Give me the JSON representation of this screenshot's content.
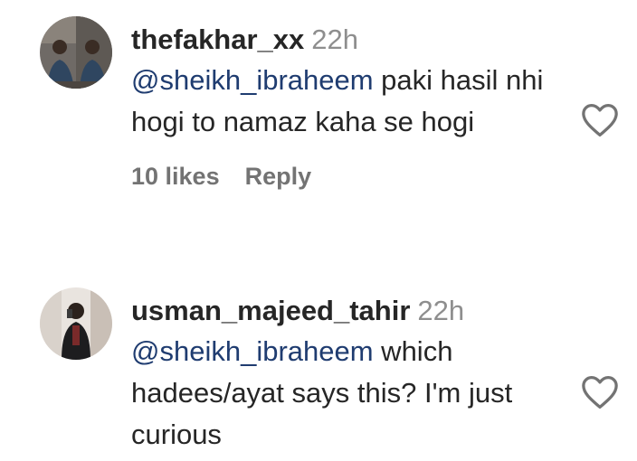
{
  "comments": [
    {
      "username": "thefakhar_xx",
      "time": "22h",
      "mention": "@sheikh_ibraheem",
      "text": " paki hasil nhi hogi to namaz kaha se hogi",
      "likes": "10 likes",
      "reply": "Reply",
      "avatar": "profile-photo"
    },
    {
      "username": "usman_majeed_tahir",
      "time": "22h",
      "mention": "@sheikh_ibraheem",
      "text": " which hadees/ayat says this? I'm just curious",
      "avatar": "profile-photo"
    }
  ],
  "icons": {
    "like": "heart-outline-icon"
  },
  "colors": {
    "text": "#262626",
    "muted": "#737373",
    "timestamp": "#8e8e8e",
    "mention": "#1f3c70"
  }
}
